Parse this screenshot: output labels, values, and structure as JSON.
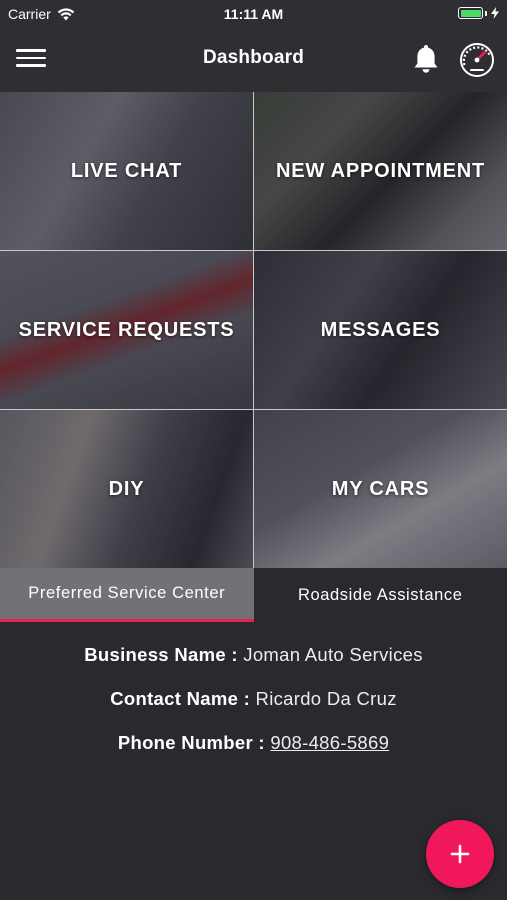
{
  "status_bar": {
    "carrier": "Carrier",
    "time": "11:11 AM"
  },
  "nav": {
    "title": "Dashboard"
  },
  "tiles": [
    {
      "label": "LIVE CHAT"
    },
    {
      "label": "NEW APPOINTMENT"
    },
    {
      "label": "SERVICE REQUESTS"
    },
    {
      "label": "MESSAGES"
    },
    {
      "label": "DIY"
    },
    {
      "label": "MY CARS"
    }
  ],
  "tabs": [
    {
      "label": "Preferred Service Center",
      "active": true
    },
    {
      "label": "Roadside Assistance",
      "active": false
    }
  ],
  "service_center": {
    "business_key": "Business Name :",
    "business_value": "Joman Auto Services",
    "contact_key": "Contact Name :",
    "contact_value": "Ricardo Da Cruz",
    "phone_key": "Phone Number :",
    "phone_value": "908-486-5869"
  },
  "colors": {
    "accent": "#ec1e58",
    "fab": "#f0185a",
    "background": "#2a292e",
    "battery": "#4cd964"
  },
  "icons": {
    "menu": "hamburger-menu-icon",
    "bell": "bell-icon",
    "gauge": "speedometer-icon",
    "fab": "plus-icon"
  }
}
